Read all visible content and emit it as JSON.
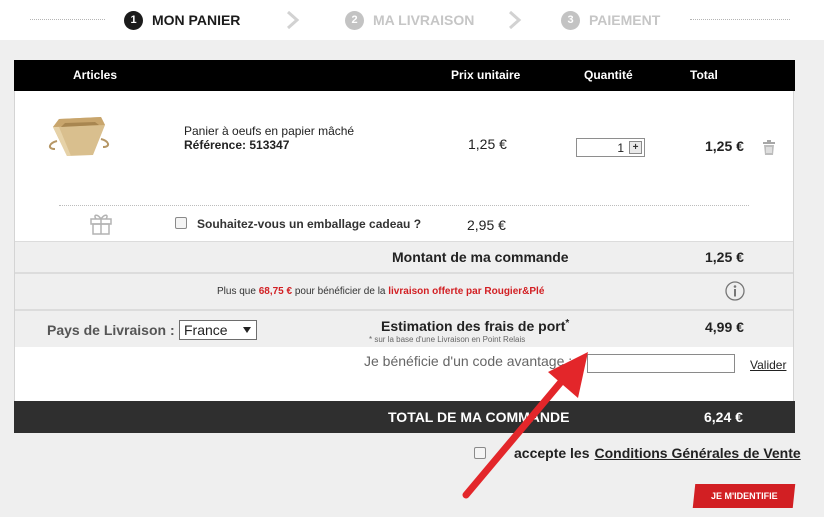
{
  "stepper": {
    "steps": [
      {
        "num": "1",
        "label": "MON PANIER"
      },
      {
        "num": "2",
        "label": "MA LIVRAISON"
      },
      {
        "num": "3",
        "label": "PAIEMENT"
      }
    ]
  },
  "table": {
    "headers": {
      "articles": "Articles",
      "unit_price": "Prix unitaire",
      "quantity": "Quantité",
      "total": "Total"
    }
  },
  "item": {
    "name": "Panier à oeufs en papier mâché",
    "reference": "Référence: 513347",
    "unit_price": "1,25 €",
    "quantity": "1",
    "plus": "+",
    "total": "1,25 €"
  },
  "gift": {
    "label": "Souhaitez-vous un emballage cadeau ?",
    "price": "2,95 €"
  },
  "order_amount": {
    "label": "Montant de ma commande",
    "value": "1,25 €"
  },
  "shipping_notice": {
    "prefix": "Plus que ",
    "amount": "68,75 €",
    "middle": " pour bénéficier de la ",
    "highlight": "livraison offerte par Rougier&Plé"
  },
  "delivery": {
    "country_label": "Pays de Livraison :",
    "country_value": "France",
    "shipping_label": "Estimation des frais de port",
    "shipping_asterisk": "*",
    "shipping_note": "* sur la base d'une Livraison en Point Relais",
    "shipping_value": "4,99 €"
  },
  "promo": {
    "label": "Je bénéficie d'un code avantage :",
    "input_value": "",
    "validate": "Valider"
  },
  "total": {
    "label": "TOTAL DE MA COMMANDE",
    "value": "6,24 €"
  },
  "cgv": {
    "prefix": "accepte les",
    "link": "Conditions Générales de Vente"
  },
  "cta": {
    "label": "JE M'IDENTIFIE"
  },
  "colors": {
    "accent_red": "#d21f23",
    "header_black": "#000000",
    "total_bar": "#2f2f2f"
  }
}
